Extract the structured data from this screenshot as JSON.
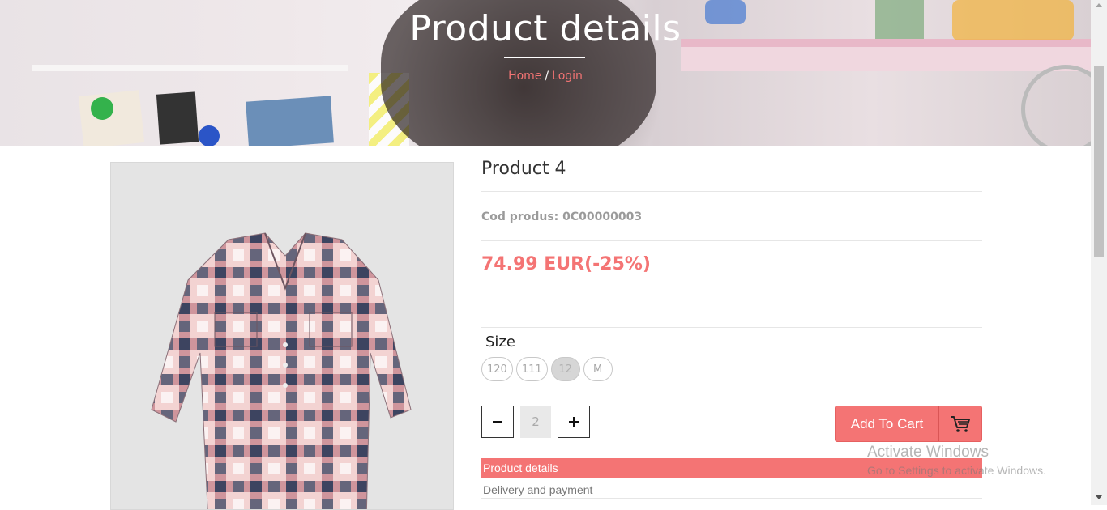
{
  "hero": {
    "title": "Product details",
    "breadcrumb": {
      "home": "Home",
      "separator": "/",
      "current": "Login"
    }
  },
  "product": {
    "name": "Product 4",
    "code_label": "Cod produs:",
    "code_value": "0C00000003",
    "price": "74.99 EUR(-25%)",
    "size_label": "Size",
    "sizes": [
      "120",
      "111",
      "12",
      "M"
    ],
    "selected_size": "12",
    "quantity": "2",
    "quantity_minus": "−",
    "quantity_plus": "+",
    "add_to_cart": "Add To Cart"
  },
  "tabs": {
    "details": "Product details",
    "delivery": "Delivery and payment"
  },
  "watermark": {
    "title": "Activate Windows",
    "subtitle": "Go to Settings to activate Windows."
  },
  "colors": {
    "accent": "#f47474",
    "muted": "#9a9a9a"
  },
  "icons": [
    "cart-icon",
    "minus-icon",
    "plus-icon"
  ]
}
